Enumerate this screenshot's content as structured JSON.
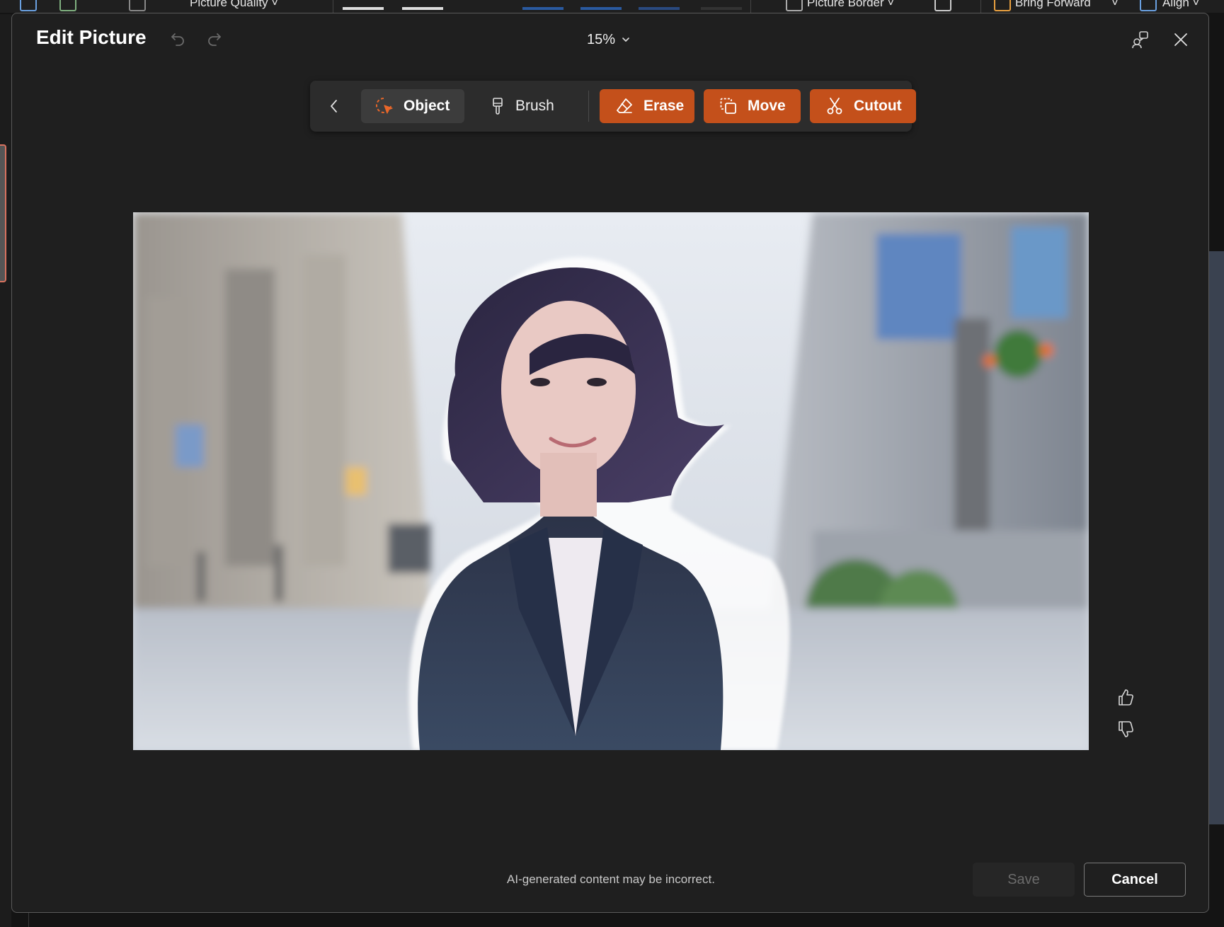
{
  "ribbon": {
    "picture_quality": "Picture Quality ˅",
    "picture_border": "Picture Border ˅",
    "bring_forward": "Bring Forward",
    "align": "Align ˅"
  },
  "dialog": {
    "title": "Edit Picture",
    "zoom_level": "15%",
    "disclaimer": "AI-generated content may be incorrect."
  },
  "toolbar": {
    "object_label": "Object",
    "brush_label": "Brush",
    "erase_label": "Erase",
    "move_label": "Move",
    "cutout_label": "Cutout"
  },
  "actions": {
    "save_label": "Save",
    "cancel_label": "Cancel"
  },
  "colors": {
    "accent": "#c4501b",
    "dialog_bg": "#1f1f1f",
    "toolbar_bg": "#2c2c2c"
  },
  "icons": {
    "back": "chevron-left-icon",
    "object": "object-select-icon",
    "brush": "brush-icon",
    "erase": "eraser-icon",
    "move": "move-icon",
    "cutout": "scissors-icon",
    "undo": "undo-icon",
    "redo": "redo-icon",
    "share": "share-feedback-icon",
    "close": "close-icon",
    "thumbs_up": "thumbs-up-icon",
    "thumbs_down": "thumbs-down-icon"
  }
}
